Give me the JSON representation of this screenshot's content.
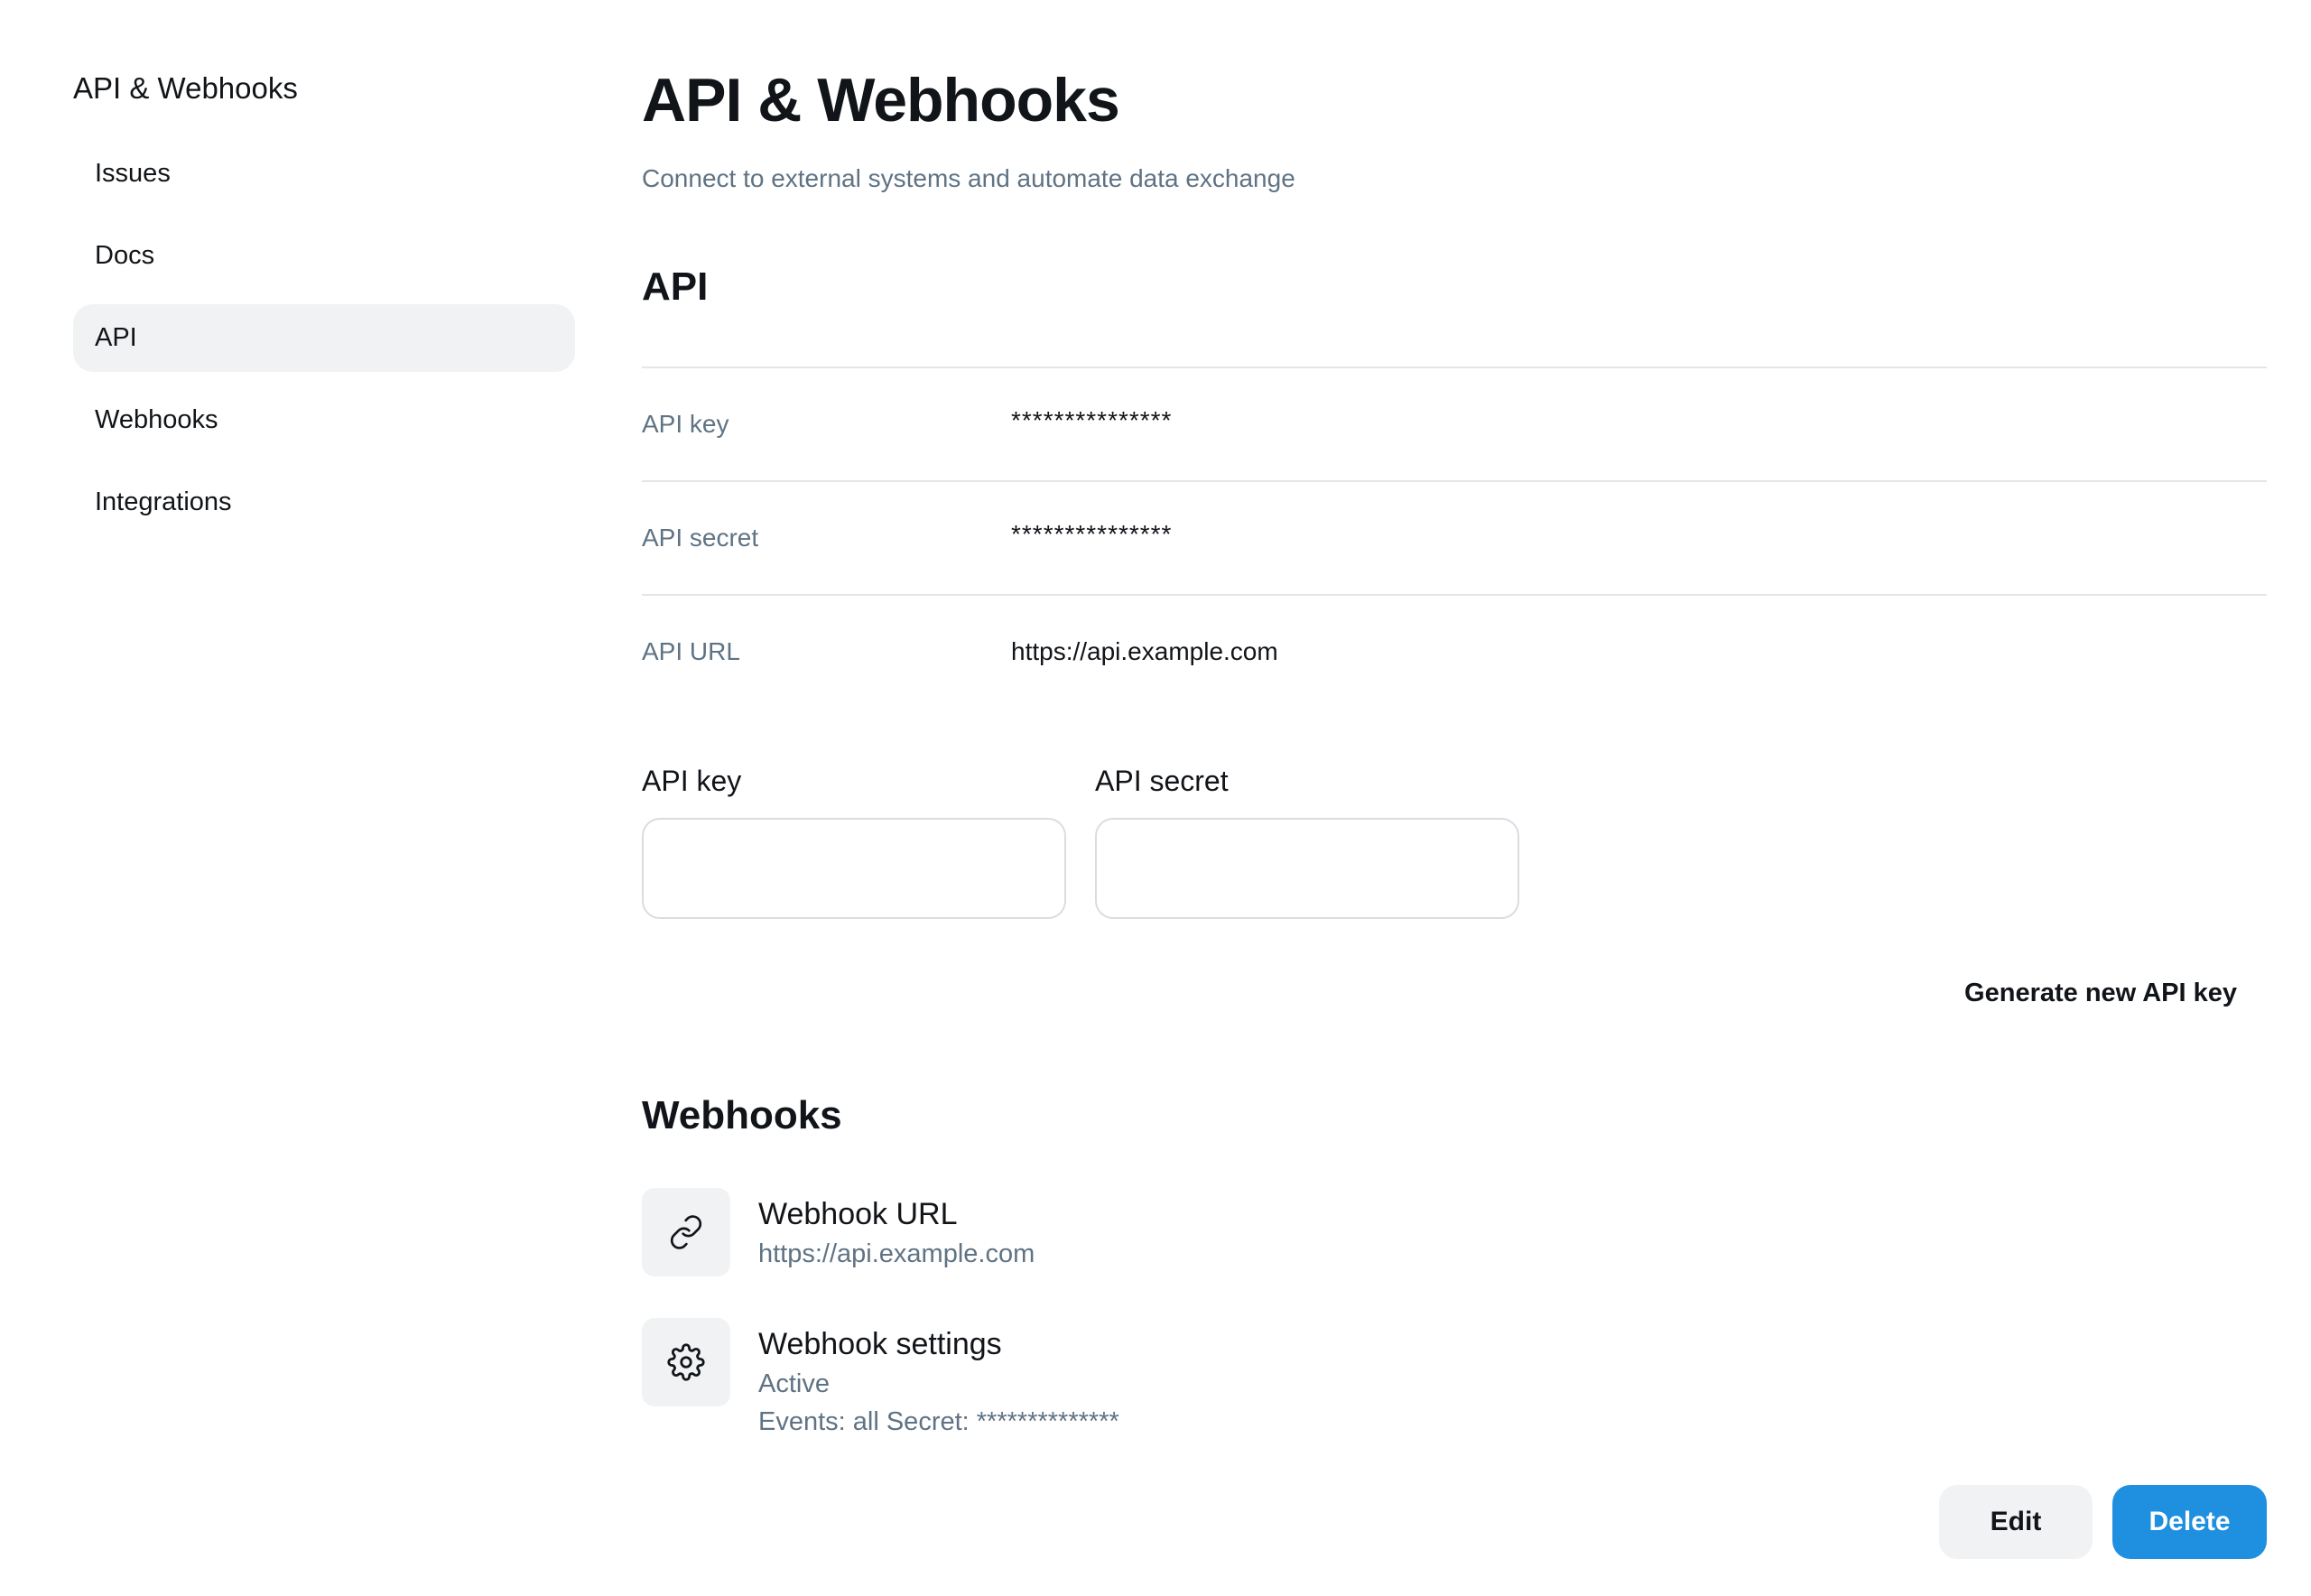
{
  "sidebar": {
    "title": "API & Webhooks",
    "items": [
      {
        "label": "Issues",
        "active": false
      },
      {
        "label": "Docs",
        "active": false
      },
      {
        "label": "API",
        "active": true
      },
      {
        "label": "Webhooks",
        "active": false
      },
      {
        "label": "Integrations",
        "active": false
      }
    ]
  },
  "header": {
    "title": "API & Webhooks",
    "subtitle": "Connect to external systems and automate data exchange"
  },
  "api": {
    "section_title": "API",
    "rows": [
      {
        "label": "API key",
        "value": "***************"
      },
      {
        "label": "API secret",
        "value": "***************"
      },
      {
        "label": "API URL",
        "value": "https://api.example.com"
      }
    ],
    "form": {
      "key_label": "API key",
      "key_value": "",
      "secret_label": "API secret",
      "secret_value": ""
    },
    "generate_label": "Generate new API key"
  },
  "webhooks": {
    "section_title": "Webhooks",
    "url_item": {
      "icon": "link-icon",
      "title": "Webhook URL",
      "value": "https://api.example.com"
    },
    "settings_item": {
      "icon": "gear-icon",
      "title": "Webhook settings",
      "status": "Active",
      "details": "Events: all Secret: **************"
    }
  },
  "actions": {
    "edit_label": "Edit",
    "delete_label": "Delete"
  },
  "colors": {
    "accent": "#1f8fe0",
    "muted_text": "#5f7384",
    "active_nav_bg": "#f1f2f4",
    "divider": "#e3e6e9"
  }
}
